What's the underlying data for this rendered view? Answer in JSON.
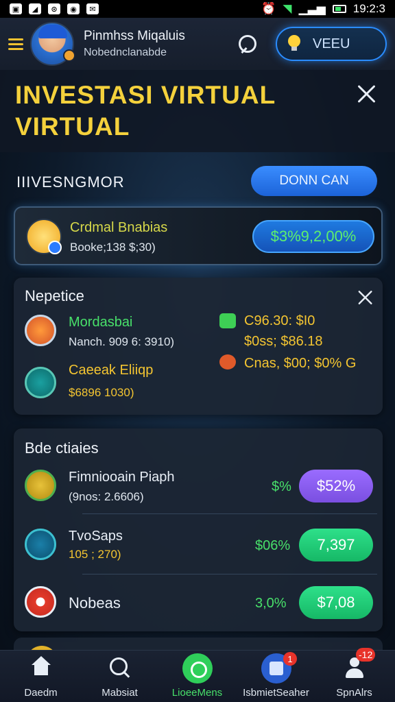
{
  "status_bar": {
    "time": "19:2:3"
  },
  "header": {
    "user_name": "Pinmhss Miqaluis",
    "user_subtitle": "Nobednclanabde",
    "veeu_label": "VEEU"
  },
  "title": {
    "text": "INVESTASI VIRTUAL VIRTUAL"
  },
  "section": {
    "heading": "IIIVESNGMOR",
    "button_label": "DONN CAN"
  },
  "featured": {
    "name": "Crdmal Bnabias",
    "subtitle": "Booke;138 $;30)",
    "value": "$3%9,2,00%"
  },
  "nepetice": {
    "title": "Nepetice",
    "items": [
      {
        "name": "Mordasbai",
        "subtitle": "Nanch. 909 6: 3910)"
      },
      {
        "name": "Caeeak Eliiqp",
        "subtitle": "$6896 1030)"
      }
    ],
    "stats": [
      {
        "line1": "C96.30: $I0",
        "line2": "$0ss; $86.18"
      },
      {
        "line1": "Cnas, $00; $0% G"
      }
    ]
  },
  "bde_chaies": {
    "title": "Bde ctiaies",
    "items": [
      {
        "name": "Fimniooain Piaph",
        "subtitle": "(9nos: 2.6606)",
        "percent": "$%",
        "value": "$52%",
        "color": "#8f63f8"
      },
      {
        "name": "TvoSaps",
        "subtitle": "105 ; 270)",
        "percent": "$06%",
        "value": "7,397",
        "color": "#22d27a"
      },
      {
        "name": "Nobeas",
        "subtitle": "",
        "percent": "3,0%",
        "value": "$7,08",
        "color": "#22d27a"
      }
    ]
  },
  "bottom_nav": {
    "items": [
      {
        "label": "Daedm"
      },
      {
        "label": "Mabsiat"
      },
      {
        "label": "LioeeMens"
      },
      {
        "label": "IsbmietSeaher",
        "badge": "1"
      },
      {
        "label": "SpnAlrs",
        "badge": "-12"
      }
    ]
  }
}
